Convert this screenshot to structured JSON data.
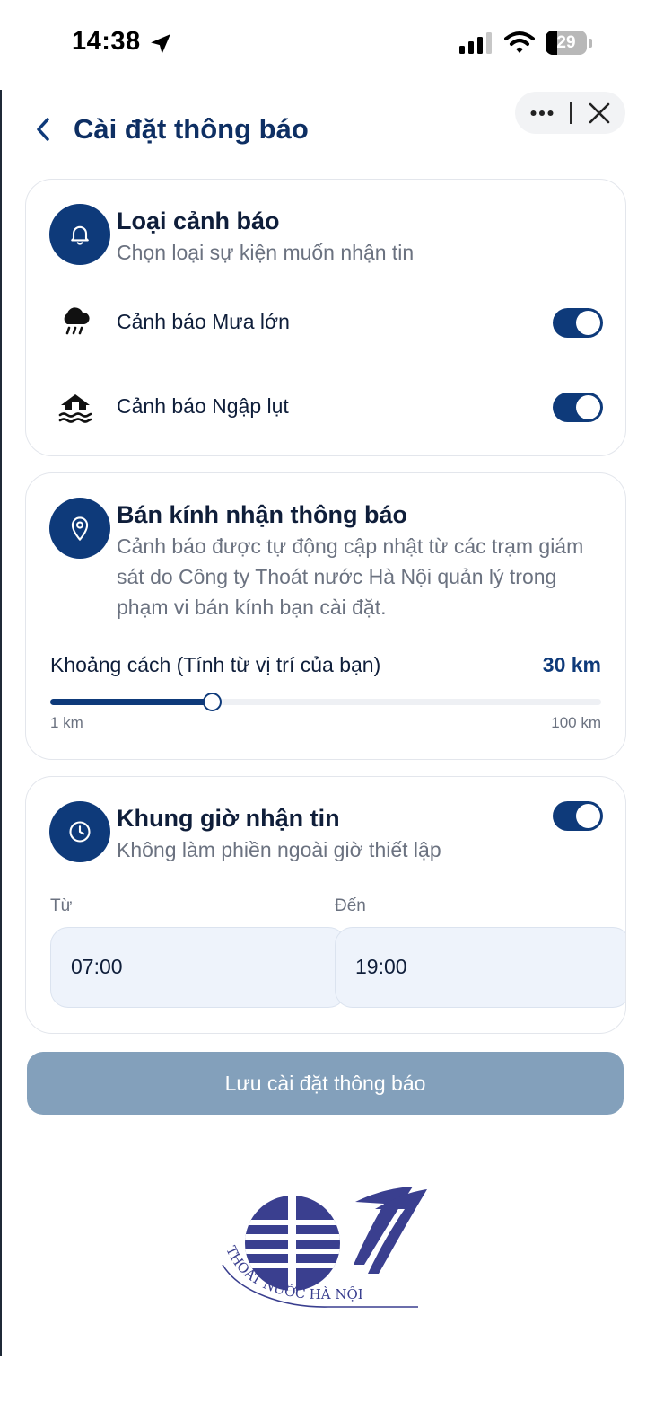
{
  "status_bar": {
    "time": "14:38",
    "battery": "29",
    "battery_level": 0.29
  },
  "header": {
    "title": "Cài đặt thông báo",
    "back_icon": "chevron-left-icon",
    "more_icon": "more-horizontal-icon",
    "close_icon": "close-icon"
  },
  "alert_types": {
    "title": "Loại cảnh báo",
    "subtitle": "Chọn loại sự kiện muốn nhận tin",
    "icon": "bell-icon",
    "items": [
      {
        "label": "Cảnh báo Mưa lớn",
        "icon": "heavy-rain-icon",
        "enabled": true
      },
      {
        "label": "Cảnh báo Ngập lụt",
        "icon": "flood-icon",
        "enabled": true
      }
    ]
  },
  "radius": {
    "title": "Bán kính nhận thông báo",
    "description": "Cảnh báo được tự động cập nhật từ các trạm giám sát do Công ty Thoát nước Hà Nội quản lý trong phạm vi bán kính bạn cài đặt.",
    "icon": "location-pin-icon",
    "distance_label": "Khoảng cách (Tính từ vị trí của bạn)",
    "distance_value": "30 km",
    "slider_value": 30,
    "slider_min": 1,
    "slider_max": 100,
    "min_label": "1 km",
    "max_label": "100 km"
  },
  "quiet_hours": {
    "title": "Khung giờ nhận tin",
    "subtitle": "Không làm phiền ngoài giờ thiết lập",
    "icon": "clock-icon",
    "enabled": true,
    "from_label": "Từ",
    "to_label": "Đến",
    "from_value": "07:00",
    "to_value": "19:00"
  },
  "save_button": "Lưu cài đặt thông báo",
  "logo": {
    "text": "THOÁT NƯỚC HÀ NỘI",
    "name": "thoat-nuoc-ha-noi-logo"
  },
  "colors": {
    "primary": "#0e3a7a",
    "title": "#0e2f63",
    "save_button": "#83a0bb",
    "muted_text": "#6b7280"
  }
}
